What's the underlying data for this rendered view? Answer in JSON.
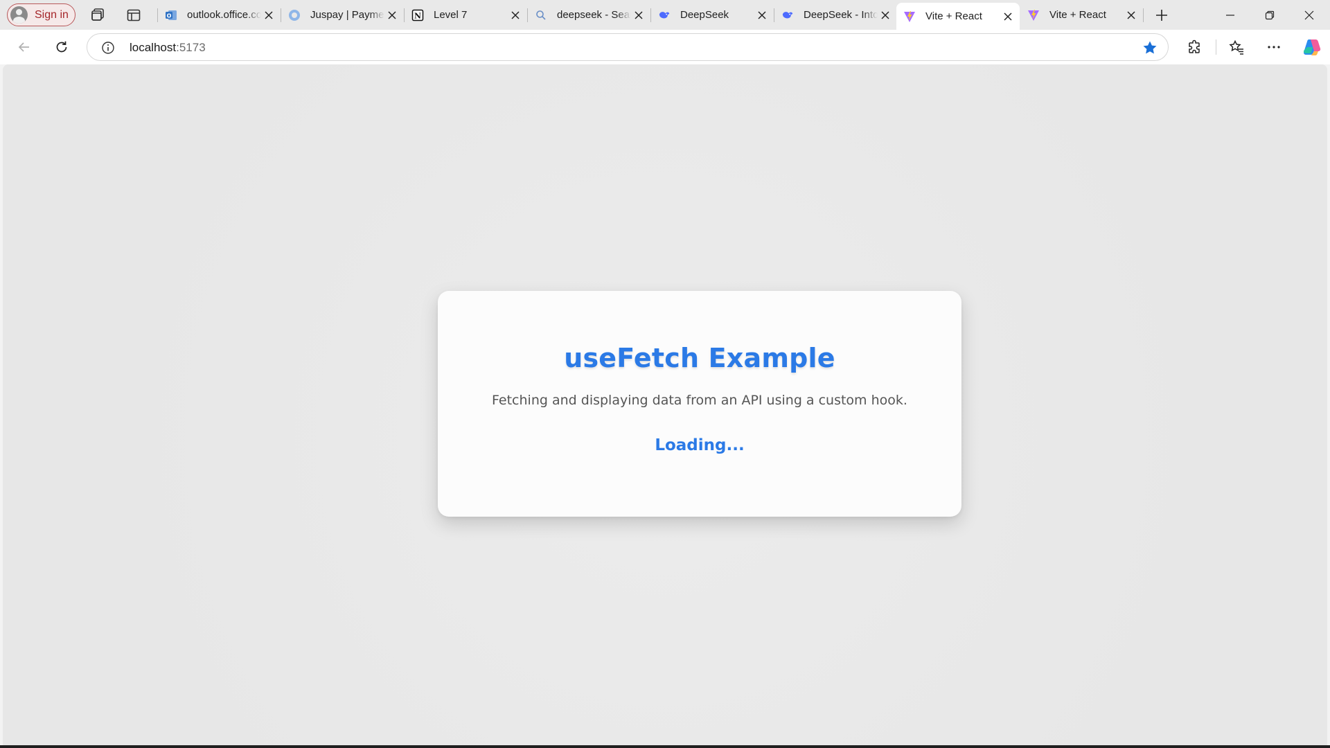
{
  "profile": {
    "signin_label": "Sign in",
    "icon": "person-avatar-icon"
  },
  "tabs": [
    {
      "title": "outlook.office.com",
      "favicon": "outlook-icon"
    },
    {
      "title": "Juspay | Payments",
      "favicon": "juspay-icon"
    },
    {
      "title": "Level 7",
      "favicon": "notion-icon"
    },
    {
      "title": "deepseek - Search",
      "favicon": "search-icon"
    },
    {
      "title": "DeepSeek",
      "favicon": "deepseek-icon"
    },
    {
      "title": "DeepSeek - Into the Unknown",
      "favicon": "deepseek-icon"
    },
    {
      "title": "Vite + React",
      "favicon": "vite-icon",
      "active": true
    },
    {
      "title": "Vite + React",
      "favicon": "vite-icon"
    }
  ],
  "address": {
    "host": "localhost",
    "port": ":5173"
  },
  "page": {
    "title": "useFetch Example",
    "subtitle": "Fetching and displaying data from an API using a custom hook.",
    "status": "Loading..."
  },
  "colors": {
    "accent": "#2b7ae6",
    "signin_border": "#b8585a",
    "star": "#1a6fd6"
  }
}
